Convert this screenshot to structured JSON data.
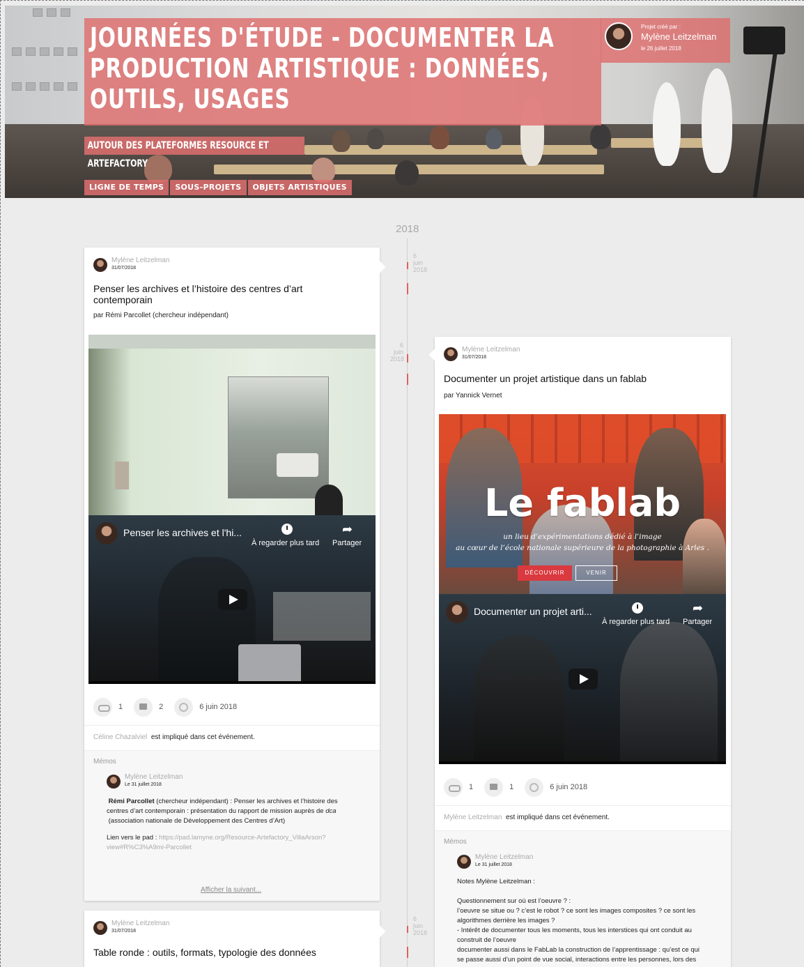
{
  "header": {
    "title": "Journées d'étude - Documenter la production artistique : données, outils, usages",
    "subtitle": "Autour des plateformes Resource et Artefactory",
    "creator_label": "Projet créé par :",
    "creator_name": "Mylène Leitzelman",
    "creator_date": "le 26 juillet 2018",
    "nav": [
      "Ligne de temps",
      "Sous-projets",
      "Objets artistiques"
    ]
  },
  "timeline": {
    "year": "2018",
    "markers": [
      {
        "day": "6",
        "month": "juin",
        "year": "2018"
      },
      {
        "day": "6",
        "month": "juin",
        "year": "2018"
      },
      {
        "day": "6",
        "month": "juin",
        "year": "2018"
      }
    ]
  },
  "cards": [
    {
      "author": "Mylène Leitzelman",
      "date": "31/07/2018",
      "title": "Penser les archives et l’histoire des centres d’art contemporain",
      "by": "par Rémi Parcollet (chercheur indépendant)",
      "video_title": "Penser les archives et l'hi...",
      "video_later": "À regarder plus tard",
      "video_share": "Partager",
      "links": "1",
      "comments": "2",
      "event_date": "6 juin 2018",
      "involved_name": "Céline Chazalviel",
      "involved_text": "est impliqué dans cet événement.",
      "memos_label": "Mémos",
      "memo_author": "Mylène Leitzelman",
      "memo_date": "Le 31 juillet 2018",
      "memo_line1_name": "Rémi Parcollet",
      "memo_line1": "(chercheur indépendant) : Penser les archives et l’histoire des",
      "memo_line2": "centres d’art contemporain : présentation du rapport de mission auprès de",
      "memo_line2_em": "dca",
      "memo_line3": "(association nationale de Développement des Centres d’Art)",
      "memo_pad_label": "Lien vers le pad :",
      "memo_pad_url1": "https://pad.lamyne.org/Resource-Artefactory_VillaArson?",
      "memo_pad_url2": "view#R%C3%A9mi-Parcollet",
      "show_next": "Afficher la suivant..."
    },
    {
      "author": "Mylène Leitzelman",
      "date": "31/07/2018",
      "title": "Documenter un projet artistique dans un fablab",
      "by": "par Yannick Vernet",
      "image_big": "Le fablab",
      "image_line1": "un lieu d’expérimentations dédié à l’image",
      "image_line2": "au cœur de l’école nationale supérieure de la photographie à Arles .",
      "image_btn1": "DÉCOUVRIR",
      "image_btn2": "VENIR",
      "video_title": "Documenter un projet arti...",
      "video_later": "À regarder plus tard",
      "video_share": "Partager",
      "links": "1",
      "comments": "1",
      "event_date": "6 juin 2018",
      "involved_name": "Mylène Leitzelman",
      "involved_text": "est impliqué dans cet événement.",
      "memos_label": "Mémos",
      "memo_author": "Mylène Leitzelman",
      "memo_date": "Le 31 juillet 2018",
      "memo_lines": [
        "Notes Mylène Leitzelman :",
        "",
        "Questionnement sur où est l’oeuvre ? :",
        "l’oeuvre se situe ou ? c’est le robot ? ce sont les images composites ? ce sont les",
        "algorithmes derrière les images ?",
        "- Intérêt de documenter tous les moments, tous les interstices qui ont conduit au",
        "construit de l’oeuvre",
        "documenter aussi dans le FabLab la construction de l’apprentissage : qu’est ce qui",
        "se passe aussi d’un point de vue social, interactions entre les personnes, lors des"
      ]
    },
    {
      "author": "Mylène Leitzelman",
      "date": "31/07/2018",
      "title": "Table ronde : outils, formats, typologie des données"
    }
  ]
}
